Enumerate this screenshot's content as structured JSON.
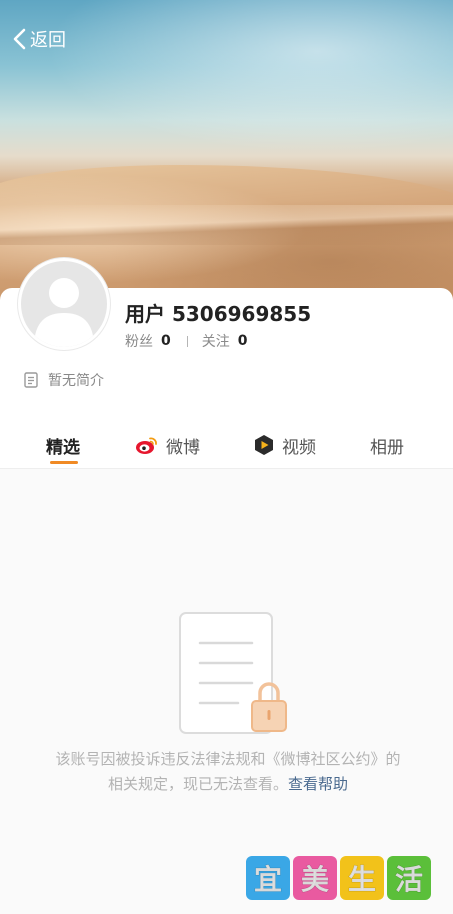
{
  "nav": {
    "back_label": "返回"
  },
  "profile": {
    "username": "用户 5306969855",
    "fans_label": "粉丝",
    "fans_count": "0",
    "following_label": "关注",
    "following_count": "0",
    "bio": "暂无简介"
  },
  "tabs": [
    {
      "label": "精选",
      "icon": "none"
    },
    {
      "label": "微博",
      "icon": "weibo-icon"
    },
    {
      "label": "视频",
      "icon": "video-play-icon"
    },
    {
      "label": "相册",
      "icon": "none"
    }
  ],
  "notice": {
    "text": "该账号因被投诉违反法律法规和《微博社区公约》的相关规定，现已无法查看。",
    "link": "查看帮助"
  },
  "watermark": {
    "chars": [
      "宜",
      "美",
      "生",
      "活"
    ],
    "colors": [
      "#3aa7e6",
      "#e95aa0",
      "#f2c21a",
      "#5bbf3a"
    ]
  },
  "colors": {
    "accent": "#f08a24",
    "link": "#4a6a8f"
  }
}
